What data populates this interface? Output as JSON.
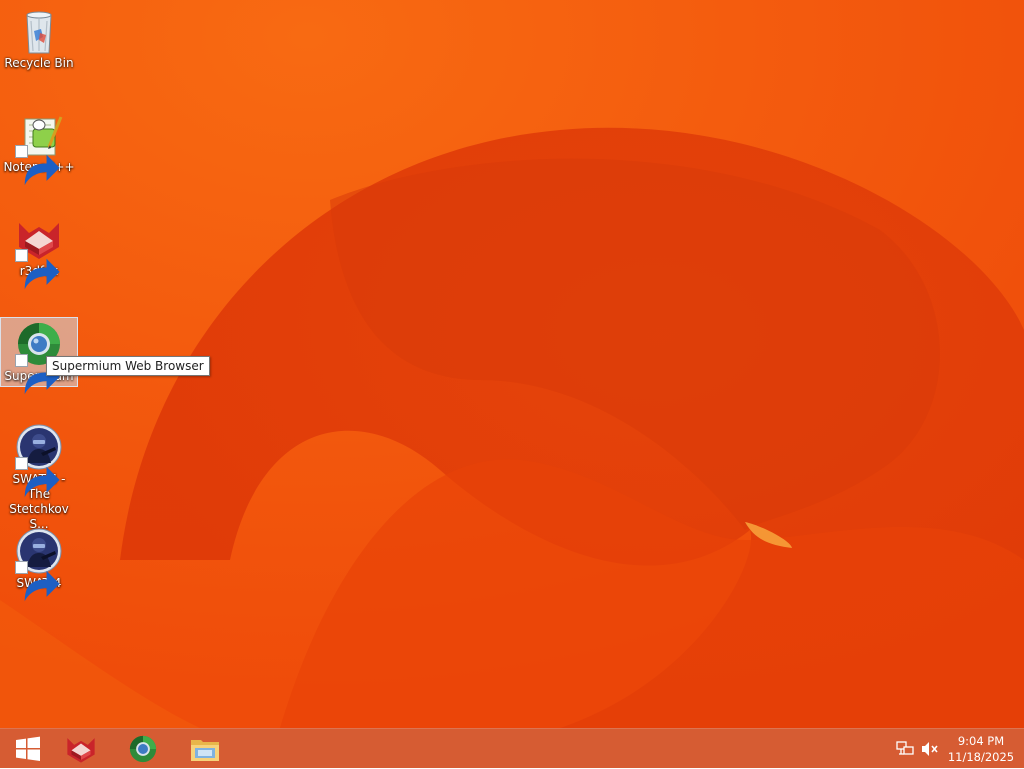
{
  "desktop": {
    "icons": [
      {
        "label": "Recycle Bin",
        "icon": "recycle-bin-icon"
      },
      {
        "label": "Notepad++",
        "icon": "notepad-plus-plus-icon"
      },
      {
        "label": "r3dfox",
        "icon": "r3dfox-icon"
      },
      {
        "label": "Supermium",
        "icon": "supermium-icon"
      },
      {
        "label": "SWAT 4 - The Stetchkov S...",
        "icon": "swat4-tss-icon"
      },
      {
        "label": "SWAT 4",
        "icon": "swat4-icon"
      }
    ],
    "tooltip": "Supermium Web Browser"
  },
  "taskbar": {
    "pinned": [
      "start-button",
      "r3dfox-icon",
      "supermium-icon",
      "file-explorer-icon"
    ],
    "tray_icons": [
      "network-icon",
      "volume-muted-icon"
    ],
    "clock_time": "9:04 PM",
    "clock_date": "11/18/2025"
  },
  "colors": {
    "wallpaper": "#ee4a0a",
    "taskbar": "#d65c33",
    "selection": "#cddceb"
  }
}
